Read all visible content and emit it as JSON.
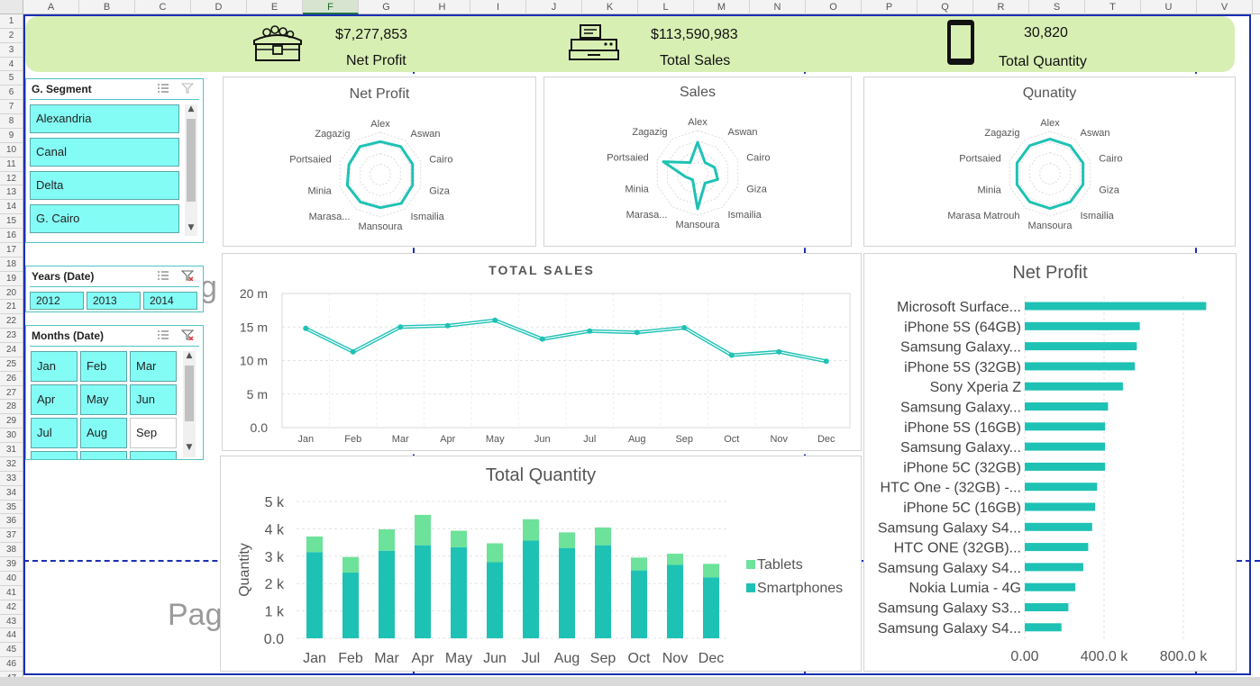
{
  "columns": [
    "A",
    "B",
    "C",
    "D",
    "E",
    "F",
    "G",
    "H",
    "I",
    "J",
    "K",
    "L",
    "M",
    "N",
    "O",
    "P",
    "Q",
    "R",
    "S",
    "T",
    "U",
    "V"
  ],
  "selected_column": "F",
  "rows": [
    "1",
    "2",
    "3",
    "4",
    "5",
    "6",
    "7",
    "8",
    "9",
    "10",
    "11",
    "12",
    "13",
    "14",
    "15",
    "16",
    "17",
    "18",
    "19",
    "20",
    "21",
    "22",
    "23",
    "24",
    "25",
    "26",
    "27",
    "28",
    "29",
    "30",
    "31",
    "32",
    "33",
    "34",
    "35",
    "36",
    "37",
    "38",
    "39",
    "40",
    "41",
    "42",
    "43",
    "44",
    "45",
    "46",
    "47"
  ],
  "kpis": [
    {
      "value": "$7,277,853",
      "label": "Net Profit",
      "icon": "treasure-chest-icon"
    },
    {
      "value": "$113,590,983",
      "label": "Total Sales",
      "icon": "cash-register-icon"
    },
    {
      "value": "30,820",
      "label": "Total Quantity",
      "icon": "smartphone-icon"
    }
  ],
  "slicers": {
    "segment": {
      "title": "G. Segment",
      "items": [
        "Alexandria",
        "Canal",
        "Delta",
        "G. Cairo"
      ]
    },
    "years": {
      "title": "Years (Date)",
      "items": [
        "2012",
        "2013",
        "2014"
      ]
    },
    "months": {
      "title": "Months (Date)",
      "items": [
        "Jan",
        "Feb",
        "Mar",
        "Apr",
        "May",
        "Jun",
        "Jul",
        "Aug",
        "Sep"
      ],
      "unselected": [
        "Sep"
      ]
    }
  },
  "watermarks": [
    "g",
    "Pag"
  ],
  "colors": {
    "accent": "#1ec2b4",
    "secondary": "#6de29a",
    "band": "#d8efb4",
    "slicer": "#84fcf6",
    "page_break": "#1a2fb5"
  },
  "chart_data": [
    {
      "type": "radar",
      "title": "Net Profit",
      "categories": [
        "Alex",
        "Aswan",
        "Cairo",
        "Giza",
        "Ismailia",
        "Mansoura",
        "Marasa...",
        "Minia",
        "Portsaied",
        "Zagazig"
      ],
      "values": [
        0.78,
        0.82,
        0.8,
        0.8,
        0.84,
        0.78,
        0.8,
        0.82,
        0.78,
        0.82
      ]
    },
    {
      "type": "radar",
      "title": "Sales",
      "categories": [
        "Alex",
        "Aswan",
        "Cairo",
        "Giza",
        "Ismailia",
        "Mansoura",
        "Marasa...",
        "Minia",
        "Portsaied",
        "Zagazig"
      ],
      "values": [
        0.72,
        0.3,
        0.42,
        0.5,
        0.3,
        0.85,
        0.2,
        0.3,
        0.85,
        0.3
      ]
    },
    {
      "type": "radar",
      "title": "Qunatity",
      "categories": [
        "Alex",
        "Aswan",
        "Cairo",
        "Giza",
        "Ismailia",
        "Mansoura",
        "Marasa Matrouh",
        "Minia",
        "Portsaied",
        "Zagazig"
      ],
      "values": [
        0.82,
        0.82,
        0.82,
        0.82,
        0.82,
        0.82,
        0.82,
        0.82,
        0.82,
        0.82
      ]
    },
    {
      "type": "line",
      "title": "TOTAL SALES",
      "categories": [
        "Jan",
        "Feb",
        "Mar",
        "Apr",
        "May",
        "Jun",
        "Jul",
        "Aug",
        "Sep",
        "Oct",
        "Nov",
        "Dec"
      ],
      "values": [
        14.8,
        11.3,
        15.0,
        15.2,
        16.0,
        13.2,
        14.4,
        14.2,
        14.9,
        10.8,
        11.3,
        9.9
      ],
      "unit": "m",
      "yticks": [
        "0.0",
        "5 m",
        "10 m",
        "15 m",
        "20 m"
      ],
      "ylim": [
        0,
        20
      ]
    },
    {
      "type": "bar",
      "stacked": true,
      "title": "Total Quantity",
      "ylabel": "Quantity",
      "categories": [
        "Jan",
        "Feb",
        "Mar",
        "Apr",
        "May",
        "Jun",
        "Jul",
        "Aug",
        "Sep",
        "Oct",
        "Nov",
        "Dec"
      ],
      "series": [
        {
          "name": "Smartphones",
          "values": [
            3150,
            2400,
            3200,
            3400,
            3330,
            2780,
            3570,
            3300,
            3400,
            2480,
            2680,
            2230
          ]
        },
        {
          "name": "Tablets",
          "values": [
            570,
            570,
            780,
            1110,
            600,
            690,
            780,
            570,
            650,
            470,
            410,
            490
          ]
        }
      ],
      "yticks": [
        "0.0",
        "1 k",
        "2 k",
        "3 k",
        "4 k",
        "5 k"
      ],
      "ylim": [
        0,
        5000
      ]
    },
    {
      "type": "bar",
      "orientation": "horizontal",
      "title": "Net Profit",
      "categories": [
        "Microsoft Surface...",
        "iPhone 5S (64GB)",
        "Samsung Galaxy...",
        "iPhone 5S (32GB)",
        "Sony Xperia Z",
        "Samsung Galaxy...",
        "iPhone 5S (16GB)",
        "Samsung Galaxy...",
        "iPhone 5C (32GB)",
        "HTC One - (32GB) -...",
        "iPhone 5C (16GB)",
        "Samsung Galaxy S4...",
        "HTC ONE (32GB)...",
        "Samsung Galaxy S4...",
        "Nokia Lumia  - 4G",
        "Samsung Galaxy S3...",
        "Samsung Galaxy S4..."
      ],
      "values": [
        915000,
        580000,
        565000,
        555000,
        495000,
        420000,
        405000,
        405000,
        405000,
        365000,
        355000,
        340000,
        320000,
        295000,
        255000,
        220000,
        185000
      ],
      "xticks": [
        "0.00",
        "400.0 k",
        "800.0 k"
      ],
      "xlim": [
        0,
        1000000
      ]
    }
  ]
}
